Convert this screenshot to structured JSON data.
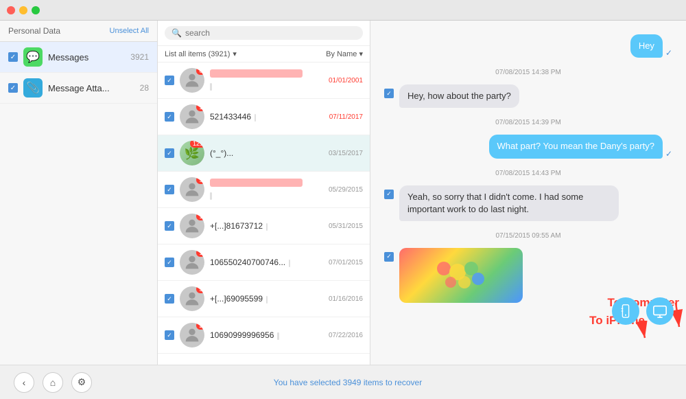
{
  "titlebar": {
    "traffic": [
      "red",
      "yellow",
      "green"
    ]
  },
  "sidebar": {
    "title": "Personal Data",
    "unselect": "Unselect All",
    "items": [
      {
        "id": "messages",
        "label": "Messages",
        "count": "3921",
        "icon": "💬",
        "iconClass": "icon-messages"
      },
      {
        "id": "attachments",
        "label": "Message Atta...",
        "count": "28",
        "icon": "📎",
        "iconClass": "icon-attachment"
      }
    ]
  },
  "listpanel": {
    "search_placeholder": "search",
    "toolbar_left": "List all items (3921)",
    "toolbar_right": "By Name",
    "conversations": [
      {
        "id": 1,
        "name": "[redacted]",
        "preview": "[redacted]",
        "date": "01/01/2001",
        "badge": "0",
        "date_color": "red",
        "selected": false
      },
      {
        "id": 2,
        "name": "521433446",
        "preview": "[redacted]",
        "date": "07/11/2017",
        "badge": "1",
        "date_color": "red",
        "selected": false
      },
      {
        "id": 3,
        "name": "(°_°)...",
        "preview": "",
        "date": "03/15/2017",
        "badge": "121",
        "date_color": "normal",
        "selected": true,
        "has_photo": true
      },
      {
        "id": 4,
        "name": "[redacted]",
        "preview": "[redacted]",
        "date": "05/29/2015",
        "badge": "9",
        "date_color": "normal",
        "selected": false
      },
      {
        "id": 5,
        "name": "+[redacted]81673712",
        "preview": "[redacted]",
        "date": "05/31/2015",
        "badge": "1",
        "date_color": "normal",
        "selected": false
      },
      {
        "id": 6,
        "name": "106550240700746...",
        "preview": "[redacted]",
        "date": "07/01/2015",
        "badge": "1",
        "date_color": "normal",
        "selected": false
      },
      {
        "id": 7,
        "name": "+[redacted]69095599",
        "preview": "[redacted]",
        "date": "01/16/2016",
        "badge": "5",
        "date_color": "normal",
        "selected": false
      },
      {
        "id": 8,
        "name": "10690999996956",
        "preview": "[redacted]",
        "date": "07/22/2016",
        "badge": "2",
        "date_color": "normal",
        "selected": false
      }
    ]
  },
  "chat": {
    "messages": [
      {
        "id": 1,
        "type": "outgoing",
        "text": "Hey",
        "time": null,
        "has_tick": true
      },
      {
        "id": 2,
        "type": "timestamp",
        "text": "07/08/2015 14:38 PM"
      },
      {
        "id": 3,
        "type": "incoming",
        "text": "Hey,  how about the party?",
        "has_checkbox": true
      },
      {
        "id": 4,
        "type": "timestamp",
        "text": "07/08/2015 14:39 PM"
      },
      {
        "id": 5,
        "type": "outgoing",
        "text": "What part? You mean the Dany's party?",
        "has_tick": true
      },
      {
        "id": 6,
        "type": "timestamp",
        "text": "07/08/2015 14:43 PM"
      },
      {
        "id": 7,
        "type": "incoming",
        "text": "Yeah, so sorry that I didn't come. I had some important work to do last night.",
        "has_checkbox": true
      },
      {
        "id": 8,
        "type": "timestamp",
        "text": "07/15/2015 09:55 AM"
      },
      {
        "id": 9,
        "type": "incoming_image",
        "has_checkbox": true
      }
    ]
  },
  "annotations": {
    "to_computer": "To Computer",
    "to_iphone": "To iPhone"
  },
  "bottombar": {
    "status": "You have selected",
    "count": "3949",
    "status_suffix": "items to recover"
  }
}
